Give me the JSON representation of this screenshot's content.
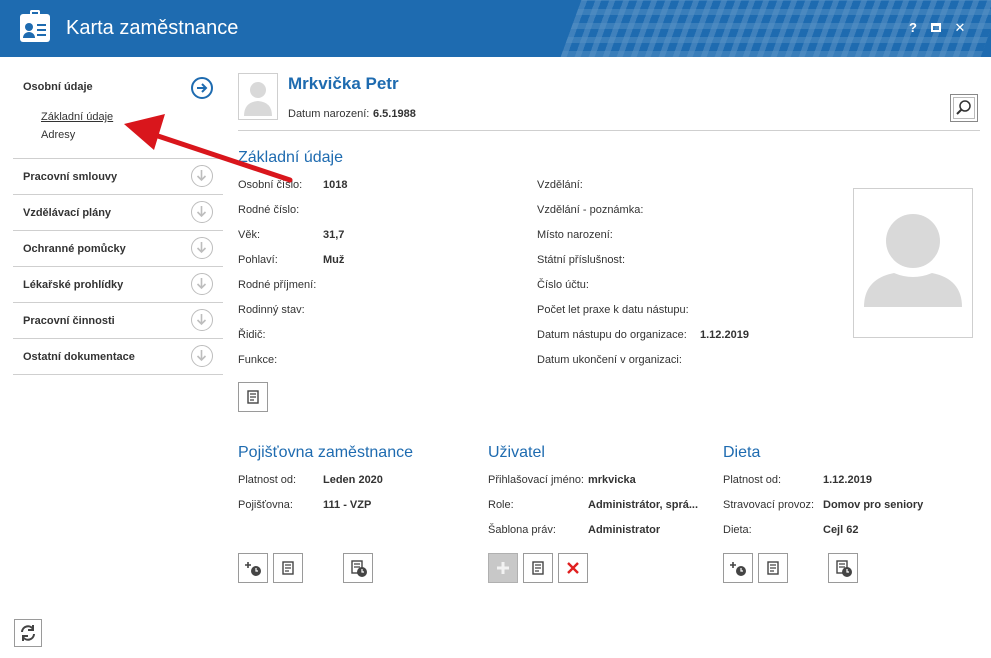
{
  "window": {
    "title": "Karta zaměstnance",
    "help_label": "?",
    "close_label": "✕"
  },
  "sidebar": {
    "first": {
      "label": "Osobní údaje",
      "sub_items": [
        {
          "label": "Základní údaje",
          "active": true
        },
        {
          "label": "Adresy",
          "active": false
        }
      ]
    },
    "items": [
      {
        "label": "Pracovní smlouvy"
      },
      {
        "label": "Vzdělávací plány"
      },
      {
        "label": "Ochranné pomůcky"
      },
      {
        "label": "Lékařské prohlídky"
      },
      {
        "label": "Pracovní činnosti"
      },
      {
        "label": "Ostatní dokumentace"
      }
    ]
  },
  "header": {
    "name": "Mrkvička Petr",
    "dob_label": "Datum narození:",
    "dob_value": "6.5.1988"
  },
  "basic": {
    "title": "Základní údaje",
    "left": [
      {
        "label": "Osobní číslo:",
        "value": "1018"
      },
      {
        "label": "Rodné číslo:",
        "value": ""
      },
      {
        "label": "Věk:",
        "value": "31,7"
      },
      {
        "label": "Pohlaví:",
        "value": "Muž"
      },
      {
        "label": "Rodné příjmení:",
        "value": ""
      },
      {
        "label": "Rodinný stav:",
        "value": ""
      },
      {
        "label": "Řidič:",
        "value": ""
      },
      {
        "label": "Funkce:",
        "value": ""
      }
    ],
    "right": [
      {
        "label": "Vzdělání:",
        "value": ""
      },
      {
        "label": "Vzdělání - poznámka:",
        "value": ""
      },
      {
        "label": "Místo narození:",
        "value": ""
      },
      {
        "label": "Státní příslušnost:",
        "value": ""
      },
      {
        "label": "Číslo účtu:",
        "value": ""
      },
      {
        "label": "Počet let praxe k datu nástupu:",
        "value": ""
      },
      {
        "label": "Datum nástupu do organizace:",
        "value": "1.12.2019"
      },
      {
        "label": "Datum ukončení v organizaci:",
        "value": ""
      }
    ]
  },
  "insurance": {
    "title": "Pojišťovna zaměstnance",
    "rows": [
      {
        "label": "Platnost od:",
        "value": "Leden 2020"
      },
      {
        "label": "Pojišťovna:",
        "value": "111 - VZP"
      }
    ]
  },
  "user": {
    "title": "Uživatel",
    "rows": [
      {
        "label": "Přihlašovací jméno:",
        "value": "mrkvicka"
      },
      {
        "label": "Role:",
        "value": "Administrátor, sprá..."
      },
      {
        "label": "Šablona práv:",
        "value": "Administrator"
      }
    ]
  },
  "diet": {
    "title": "Dieta",
    "rows": [
      {
        "label": "Platnost od:",
        "value": "1.12.2019"
      },
      {
        "label": "Stravovací provoz:",
        "value": "Domov pro seniory"
      },
      {
        "label": "Dieta:",
        "value": "Cejl 62"
      }
    ]
  },
  "colors": {
    "accent": "#1e6bb0",
    "arrow": "#d9161c",
    "delete": "#e02020"
  }
}
